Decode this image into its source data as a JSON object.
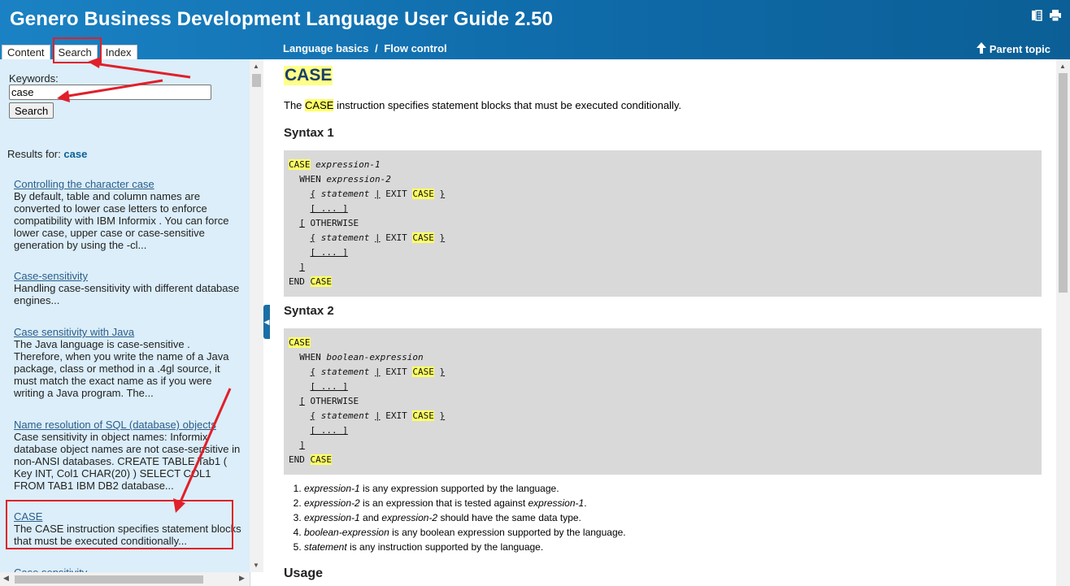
{
  "header": {
    "title": "Genero Business Development Language User Guide 2.50",
    "tabs": [
      {
        "label": "Content"
      },
      {
        "label": "Search"
      },
      {
        "label": "Index"
      }
    ],
    "breadcrumb": [
      "Language basics",
      "Flow control"
    ],
    "breadcrumb_sep": "/",
    "parent_topic": "Parent topic"
  },
  "sidebar": {
    "keywords_label": "Keywords:",
    "keywords_value": "case",
    "search_button": "Search",
    "results_prefix": "Results for:",
    "results_term": "case",
    "results": [
      {
        "title": "Controlling the character case",
        "snippet": "By default, table and column names are converted to lower case letters to enforce compatibility with IBM Informix . You can force lower case, upper case or case-sensitive generation by using the -cl..."
      },
      {
        "title": "Case-sensitivity",
        "snippet": "Handling case-sensitivity with different database engines..."
      },
      {
        "title": "Case sensitivity with Java",
        "snippet": "The Java language is case-sensitive . Therefore, when you write the name of a Java package, class or method in a .4gl source, it must match the exact name as if you were writing a Java program. The..."
      },
      {
        "title": "Name resolution of SQL (database) objects",
        "snippet": "Case sensitivity in object names: Informix database object names are not case-sensitive in non-ANSI databases. CREATE TABLE Tab1 ( Key INT, Col1 CHAR(20) ) SELECT COL1 FROM TAB1 IBM DB2 database..."
      },
      {
        "title": "CASE",
        "snippet": "The CASE instruction specifies statement blocks that must be executed conditionally..."
      },
      {
        "title": "Case sensitivity",
        "snippet": ""
      }
    ]
  },
  "content": {
    "title": "CASE",
    "intro_pre": "The",
    "intro_kw": "CASE",
    "intro_post": "instruction specifies statement blocks that must be executed conditionally.",
    "syntax1_heading": "Syntax 1",
    "syntax2_heading": "Syntax 2",
    "usage_heading": "Usage",
    "notes": [
      {
        "em": "expression-1",
        "text": " is any expression supported by the language."
      },
      {
        "em": "expression-2",
        "text": " is an expression that is tested against ",
        "em2": "expression-1",
        "tail": "."
      },
      {
        "em": "expression-1",
        "text": " and ",
        "em2": "expression-2",
        "tail": " should have the same data type."
      },
      {
        "em": "boolean-expression",
        "text": " is any boolean expression supported by the language."
      },
      {
        "em": "statement",
        "text": " is any instruction supported by the language."
      }
    ]
  }
}
